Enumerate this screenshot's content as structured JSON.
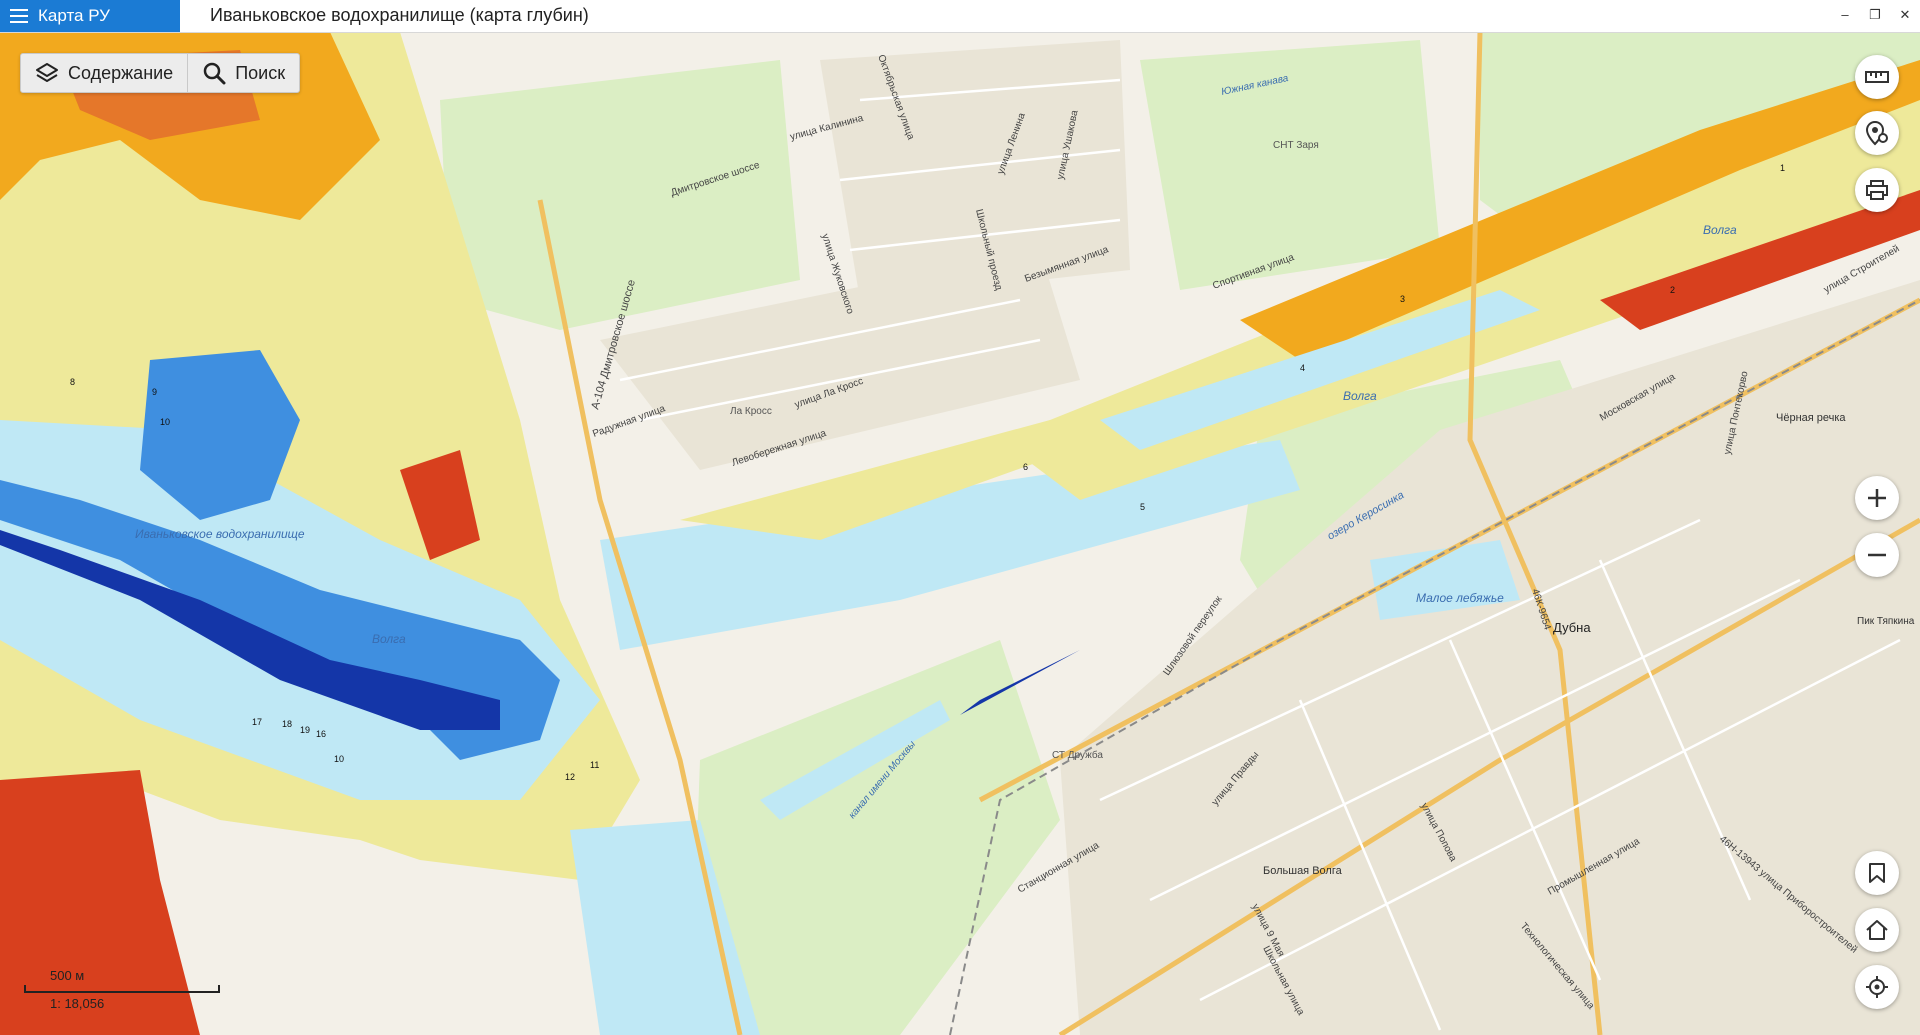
{
  "app": {
    "menu_label": "Карта РУ",
    "window_title": "Иваньковское водохранилище (карта глубин)"
  },
  "window_controls": {
    "minimize": "–",
    "restore": "❐",
    "close": "✕"
  },
  "toolbar": {
    "contents_label": "Содержание",
    "search_label": "Поиск"
  },
  "scale": {
    "distance": "500 м",
    "ratio": "1: 18,056"
  },
  "right_controls": [
    "ruler-icon",
    "pin-settings-icon",
    "print-icon",
    "zoom-in-icon",
    "zoom-out-icon",
    "bookmark-icon",
    "home-icon",
    "locate-icon"
  ],
  "colors": {
    "accent": "#1b7bd4",
    "deep_water": "#1436a8",
    "mid_water": "#3f8fe0",
    "shallow_water": "#bfe8f5",
    "shoal": "#eee99a",
    "very_shallow": "#f2a91e",
    "edge": "#d8401e",
    "land": "#f3f0e8",
    "forest": "#dbeec4"
  },
  "map_labels": {
    "reservoir": "Иваньковское водохранилище",
    "volga": "Волга",
    "canal": "канал имени Москвы",
    "kerosinka": "озеро Керосинка",
    "small_swan": "Малое лебяжье",
    "dubna": "Дубна",
    "big_volga": "Большая Волга",
    "chernaya": "Чёрная речка",
    "tyapkina": "Пик Тяпкина",
    "snt_zarya": "СНТ Заря",
    "st_druzhba": "СТ Дружба",
    "la_kross": "Ла Кросс",
    "south_canal": "Южная канава",
    "a104": "А-104 Дмитровское шоссе",
    "dmitrovskoe": "Дмитровское шоссе",
    "moskovskaya": "Московская улица",
    "stroiteley": "улица Строителей",
    "pravdy": "улица Правды",
    "sportivnaya": "Спортивная улица",
    "kalinina": "улица Калинина",
    "lenina": "улица Ленина",
    "oktyabrskaya": "Октябрьская улица",
    "raduzhnaya": "Радужная улица",
    "levoberezhnaya": "Левобережная улица",
    "stancionnaya": "Станционная улица",
    "promyshlennaya": "Промышленная улица",
    "tekhnologicheskaya": "Технологическая улица",
    "shkolnaya": "Школьная улица",
    "maya": "улица 9 Мая",
    "popova": "улица Попова",
    "shlyuzovoy": "Шлюзовой переулок",
    "road_46k": "46К-9654",
    "road_46n": "46Н-13943 улица Приборостроителей",
    "zhukovskogo": "улица Жуковского",
    "ushakova": "улица Ушакова",
    "bezymyannaya": "Безымянная улица",
    "shkolny_proezd": "Школьный проезд",
    "sportivnaya2": "Спортивная улица",
    "la_kross_st": "улица Ла Кросс",
    "ponteleeva": "улица Понтекорво"
  },
  "depth_marks": [
    "17",
    "18",
    "19",
    "16",
    "10",
    "12",
    "11",
    "10",
    "9",
    "8",
    "6",
    "5",
    "4",
    "3",
    "2",
    "1"
  ]
}
